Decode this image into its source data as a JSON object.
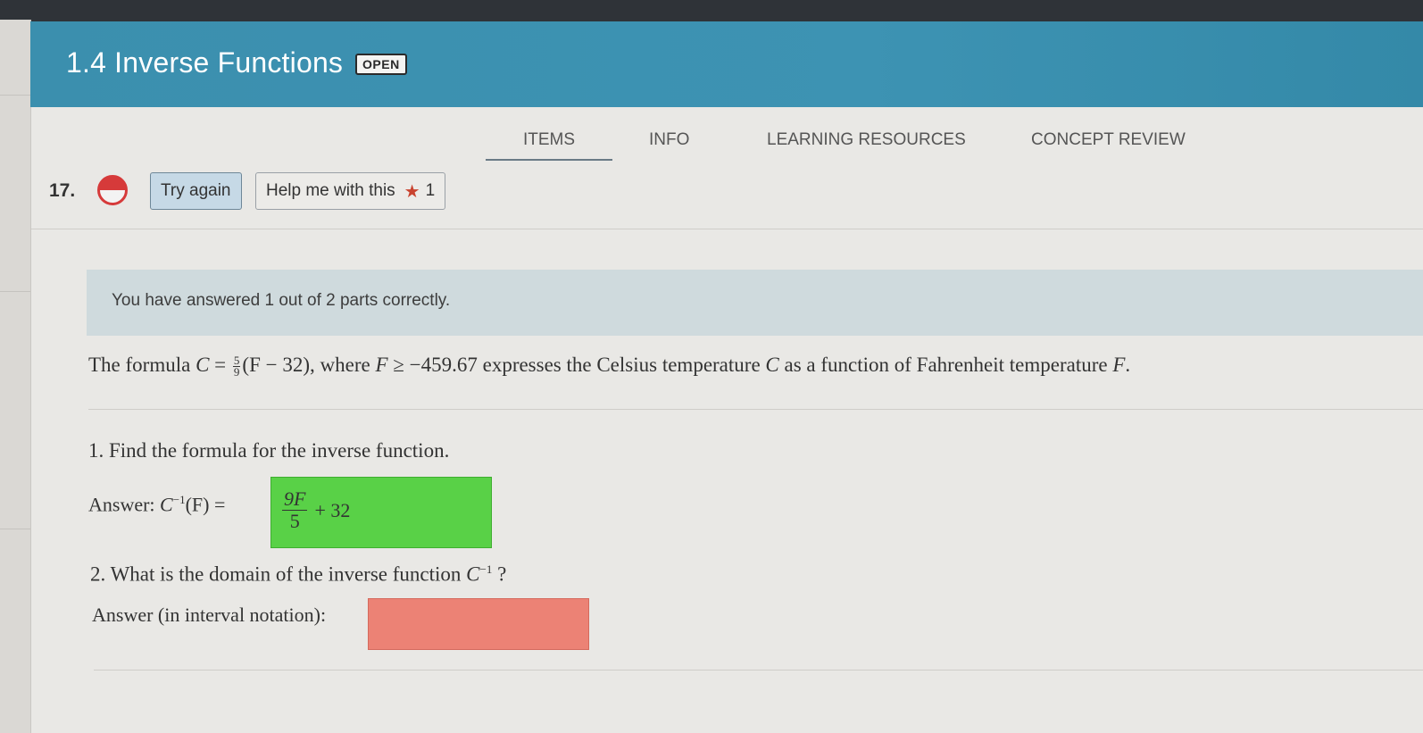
{
  "header": {
    "title": "1.4 Inverse Functions",
    "badge": "OPEN"
  },
  "tabs": [
    {
      "label": "ITEMS",
      "active": true
    },
    {
      "label": "INFO",
      "active": false
    },
    {
      "label": "LEARNING RESOURCES",
      "active": false
    },
    {
      "label": "CONCEPT REVIEW",
      "active": false
    }
  ],
  "question": {
    "number": "17.",
    "status_icon": "half-filled-circle-icon",
    "try_again_label": "Try again",
    "help_label": "Help me with this",
    "help_star_count": "1",
    "banner": "You have answered 1 out of 2 parts correctly.",
    "problem": {
      "prefix": "The formula ",
      "formula_var": "C",
      "eq": " = ",
      "frac_num": "5",
      "frac_den": "9",
      "paren": "(F − 32)",
      "where": ", where ",
      "cond_var": "F",
      "cond": " ≥ −459.67",
      "middle": " expresses the Celsius temperature ",
      "celsius_var": "C",
      "middle2": " as a function of Fahrenheit temperature ",
      "fahr_var": "F",
      "end": "."
    },
    "part1": {
      "text": "1. Find the formula for the inverse function.",
      "answer_prefix": "Answer: ",
      "answer_fn": "C",
      "answer_sup": "−1",
      "answer_arg": "(F) =",
      "answer_num": "9F",
      "answer_den": "5",
      "answer_tail": "+ 32",
      "status": "correct",
      "color": "#59d147"
    },
    "part2": {
      "text": "2. What is the domain of the inverse function ",
      "fn": "C",
      "sup": "−1",
      "qmark": " ?",
      "answer_label": "Answer (in interval notation):",
      "answer_value": "",
      "status": "incorrect",
      "color": "#ec8275"
    }
  }
}
